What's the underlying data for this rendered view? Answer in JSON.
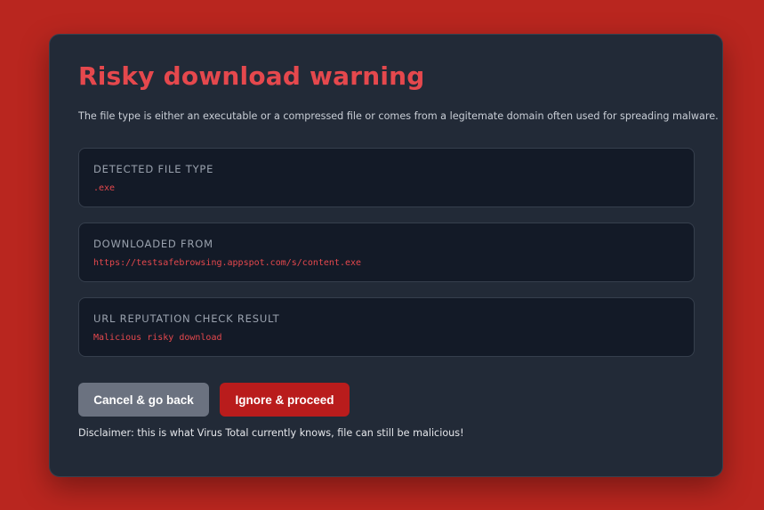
{
  "dialog": {
    "title": "Risky download warning",
    "description": "The file type is either an executable or a compressed file or comes from a legitemate domain often used for spreading malware.",
    "sections": [
      {
        "label": "DETECTED FILE TYPE",
        "value": ".exe"
      },
      {
        "label": "DOWNLOADED FROM",
        "value": "https://testsafebrowsing.appspot.com/s/content.exe"
      },
      {
        "label": "URL REPUTATION CHECK RESULT",
        "value": "Malicious risky download"
      }
    ],
    "buttons": {
      "cancel_label": "Cancel & go back",
      "proceed_label": "Ignore & proceed"
    },
    "disclaimer": "Disclaimer: this is what Virus Total currently knows, file can still be malicious!"
  },
  "colors": {
    "page_background": "#b9261f",
    "dialog_background": "#222a37",
    "accent_red": "#e5484d",
    "cancel_button": "#6b7280",
    "proceed_button": "#b91c1c"
  }
}
